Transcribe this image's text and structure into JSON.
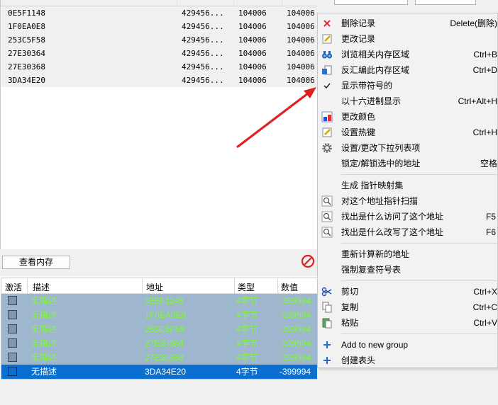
{
  "results": {
    "rows": [
      {
        "address": "0E5F1148",
        "value": "429456...",
        "prev": "104006",
        "first": "104006"
      },
      {
        "address": "1F0EA0E8",
        "value": "429456...",
        "prev": "104006",
        "first": "104006"
      },
      {
        "address": "253C5F58",
        "value": "429456...",
        "prev": "104006",
        "first": "104006"
      },
      {
        "address": "27E30364",
        "value": "429456...",
        "prev": "104006",
        "first": "104006"
      },
      {
        "address": "27E30368",
        "value": "429456...",
        "prev": "104006",
        "first": "104006"
      },
      {
        "address": "3DA34E20",
        "value": "429456...",
        "prev": "104006",
        "first": "104006"
      }
    ]
  },
  "toolbar": {
    "view_memory_label": "查看内存"
  },
  "address_list": {
    "headers": {
      "active": "激活",
      "description": "描述",
      "address": "地址",
      "type": "类型",
      "value": "数值"
    },
    "rows": [
      {
        "description": "无描述",
        "address": "0E5F1148",
        "type": "4字节",
        "value": "-399994"
      },
      {
        "description": "无描述",
        "address": "1F0EA0E8",
        "type": "4字节",
        "value": "-399994"
      },
      {
        "description": "无描述",
        "address": "253C5F58",
        "type": "4字节",
        "value": "-399994"
      },
      {
        "description": "无描述",
        "address": "27E30364",
        "type": "4字节",
        "value": "-399994"
      },
      {
        "description": "无描述",
        "address": "27E30368",
        "type": "4字节",
        "value": "-399994"
      },
      {
        "description": "无描述",
        "address": "3DA34E20",
        "type": "4字节",
        "value": "-399994"
      }
    ]
  },
  "menu": {
    "items": [
      {
        "label": "删除记录",
        "shortcut": "Delete(删除)",
        "icon": "delete-x-icon"
      },
      {
        "label": "更改记录",
        "shortcut": "",
        "icon": "edit-record-icon"
      },
      {
        "label": "浏览相关内存区域",
        "shortcut": "Ctrl+B",
        "icon": "binoculars-icon"
      },
      {
        "label": "反汇编此内存区域",
        "shortcut": "Ctrl+D",
        "icon": "disassemble-icon"
      },
      {
        "label": "显示带符号的",
        "shortcut": "",
        "icon": "checkmark-icon"
      },
      {
        "label": "以十六进制显示",
        "shortcut": "Ctrl+Alt+H",
        "icon": ""
      },
      {
        "label": "更改颜色",
        "shortcut": "",
        "icon": "color-palette-icon"
      },
      {
        "label": "设置热键",
        "shortcut": "Ctrl+H",
        "icon": "hotkey-icon"
      },
      {
        "label": "设置/更改下拉列表项",
        "shortcut": "",
        "icon": "gear-icon"
      },
      {
        "label": "锁定/解锁选中的地址",
        "shortcut": "空格",
        "icon": ""
      },
      {
        "label": "生成 指针映射集",
        "shortcut": "",
        "icon": ""
      },
      {
        "label": "对这个地址指针扫描",
        "shortcut": "",
        "icon": "pointer-scan-icon"
      },
      {
        "label": "找出是什么访问了这个地址",
        "shortcut": "F5",
        "icon": "find-access-icon"
      },
      {
        "label": "找出是什么改写了这个地址",
        "shortcut": "F6",
        "icon": "find-write-icon"
      },
      {
        "label": "重新计算新的地址",
        "shortcut": "",
        "icon": ""
      },
      {
        "label": "强制复查符号表",
        "shortcut": "",
        "icon": ""
      },
      {
        "label": "剪切",
        "shortcut": "Ctrl+X",
        "icon": "scissors-icon"
      },
      {
        "label": "复制",
        "shortcut": "Ctrl+C",
        "icon": "copy-icon"
      },
      {
        "label": "粘贴",
        "shortcut": "Ctrl+V",
        "icon": "paste-icon"
      },
      {
        "label": "Add to new group",
        "shortcut": "",
        "icon": "plus-icon"
      },
      {
        "label": "创建表头",
        "shortcut": "",
        "icon": "plus-icon"
      }
    ]
  },
  "colors": {
    "row_bg": "#9fb6cf",
    "row_text": "#7cfc32",
    "selected_bg": "#0a6fd0",
    "arrow": "#e02020",
    "delete_icon": "#e0302f",
    "plus_icon": "#1a73d9"
  }
}
